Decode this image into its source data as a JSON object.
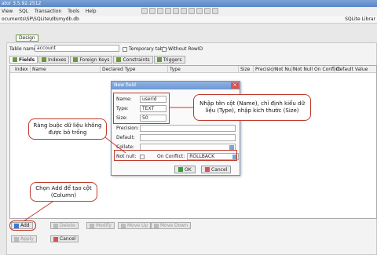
{
  "window": {
    "title": "ator 3.5.92.2512"
  },
  "menu": [
    "View",
    "SQL",
    "Transaction",
    "Tools",
    "Help"
  ],
  "path": {
    "left": "ocuments\\SP\\SQLite\\db\\mydb.db",
    "right": "SQLite Librar"
  },
  "design_tab": "Design",
  "table": {
    "name_label": "Table name:",
    "name_value": "account",
    "temporary_label": "Temporary table",
    "without_rowid_label": "Without RowID"
  },
  "tabs": [
    "Fields",
    "Indexes",
    "Foreign Keys",
    "Constraints",
    "Triggers"
  ],
  "columns": [
    "Index",
    "Name",
    "Declared Type",
    "Type",
    "Size",
    "Precision",
    "Not Null",
    "Not Null On Conflict",
    "Default Value"
  ],
  "bottom_buttons": [
    "Add",
    "Delete",
    "Modify",
    "Move Up",
    "Move Down"
  ],
  "action_buttons": [
    "Apply",
    "Cancel"
  ],
  "dialog": {
    "title": "New field",
    "name_label": "Name:",
    "name_value": "userid",
    "type_label": "Type:",
    "type_value": "TEXT",
    "size_label": "Size:",
    "size_value": "50",
    "precision_label": "Precision:",
    "default_label": "Default:",
    "collate_label": "Collate:",
    "notnull_label": "Not null:",
    "onconflict_label": "On Conflict:",
    "onconflict_value": "ROLLBACK",
    "ok": "OK",
    "cancel": "Cancel"
  },
  "callouts": {
    "field_info": "Nhập tên cột (Name), chỉ định kiểu dữ liệu (Type), nhập kích thước (Size)",
    "not_null": "Ràng buộc dữ liệu không được bỏ trống",
    "add_column": "Chọn Add để tạo cột (Column)"
  },
  "colors": {
    "accent_red": "#c0392b",
    "title_blue": "#5b86c4",
    "green": "#6a9a3a"
  }
}
